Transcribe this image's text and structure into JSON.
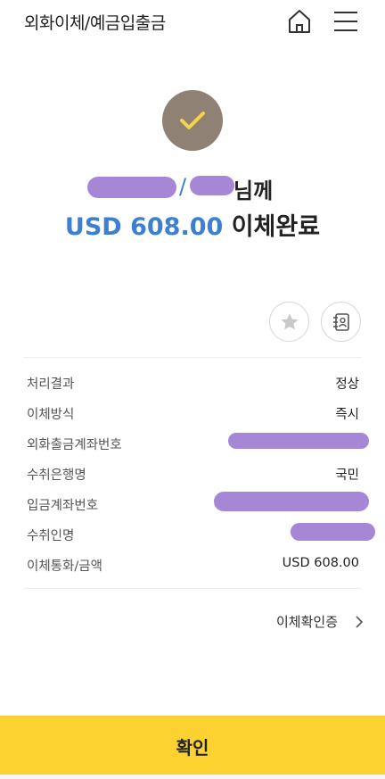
{
  "header": {
    "title": "외화이체/예금입출금",
    "home_icon": "home-icon",
    "menu_icon": "hamburger-menu-icon"
  },
  "result": {
    "status_icon": "checkmark-icon",
    "recipient_suffix": "님께",
    "recipient_slash": "/",
    "amount": "USD 608.00",
    "completed_text": "이체완료"
  },
  "actions": {
    "favorite_icon": "star-icon",
    "contact_icon": "address-book-icon"
  },
  "details": [
    {
      "label": "처리결과",
      "value": "정상"
    },
    {
      "label": "이체방식",
      "value": "즉시"
    },
    {
      "label": "외화출금계좌번호",
      "value": ""
    },
    {
      "label": "수취은행명",
      "value": "국민"
    },
    {
      "label": "입금계좌번호",
      "value": ""
    },
    {
      "label": "수취인명",
      "value": ""
    },
    {
      "label": "이체통화/금액",
      "value": "USD 608.00"
    }
  ],
  "certificate_link": "이체확인증",
  "confirm_button": "확인",
  "colors": {
    "accent_blue": "#3d7fd1",
    "confirm_yellow": "#fbd22f",
    "check_circle": "#8f8173",
    "check_mark": "#f5d34a",
    "redaction": "#a687d6"
  }
}
